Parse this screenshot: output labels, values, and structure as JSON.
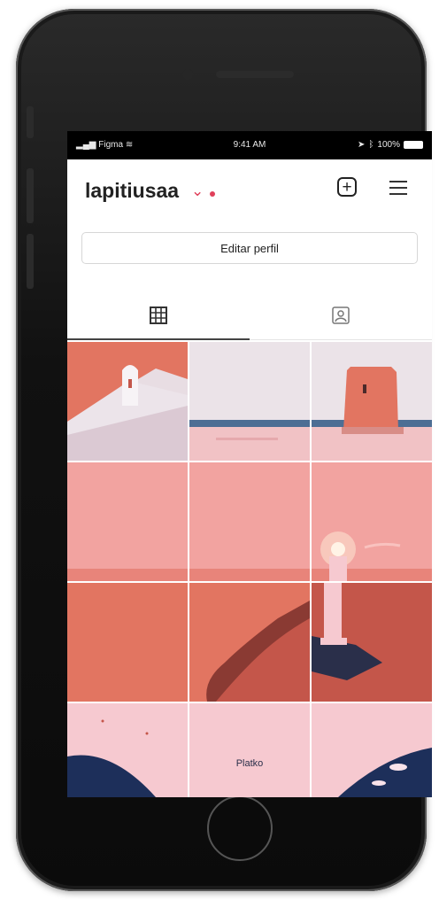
{
  "status_bar": {
    "carrier": "Figma",
    "time": "9:41 AM",
    "battery": "100%"
  },
  "profile": {
    "username": "lapitiusaa",
    "edit_button_label": "Editar perfil"
  },
  "tabs": [
    {
      "name": "grid",
      "icon": "grid-icon",
      "active": true
    },
    {
      "name": "tagged",
      "icon": "tagged-user-icon",
      "active": false
    }
  ],
  "grid": {
    "tile_count": 12,
    "caption": "Platko"
  },
  "colors": {
    "accent": "#e0405a",
    "salmon": "#f2a3a0",
    "coral": "#e27561",
    "rust": "#c4564a",
    "pink": "#f6c9d0",
    "navy": "#1d2f5a"
  }
}
